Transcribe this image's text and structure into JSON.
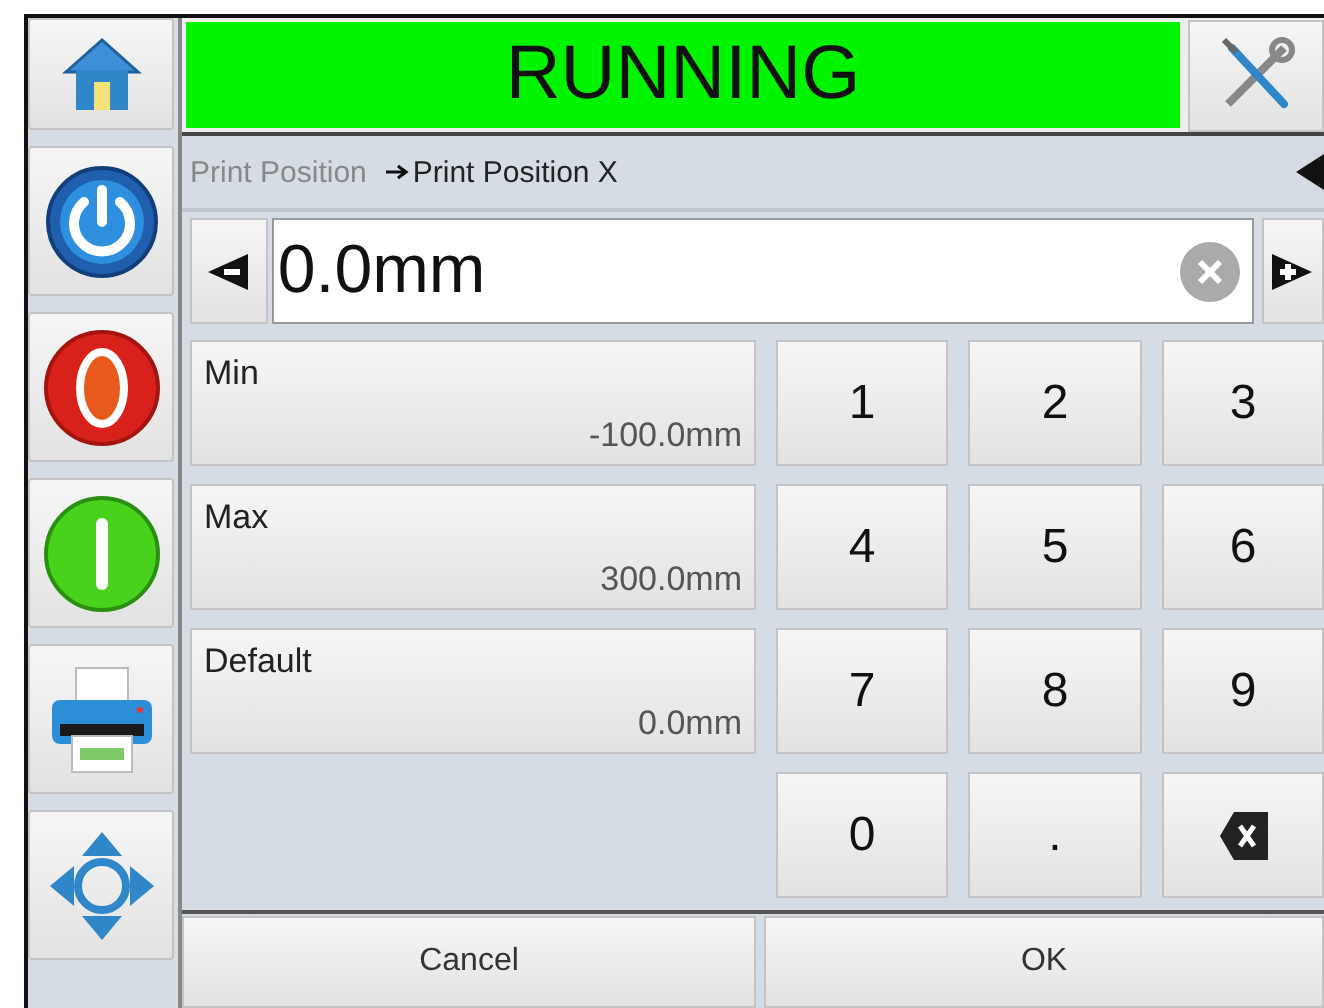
{
  "status_bar": {
    "text": "RUNNING"
  },
  "breadcrumb": {
    "parent": "Print Position",
    "current": "Print Position X"
  },
  "value_field": {
    "value": "0.0mm"
  },
  "limits": [
    {
      "label": "Min",
      "value": "-100.0mm"
    },
    {
      "label": "Max",
      "value": "300.0mm"
    },
    {
      "label": "Default",
      "value": "0.0mm"
    }
  ],
  "keypad": [
    {
      "kind": "key",
      "label": "1"
    },
    {
      "kind": "key",
      "label": "2"
    },
    {
      "kind": "key",
      "label": "3"
    },
    {
      "kind": "key",
      "label": "4"
    },
    {
      "kind": "key",
      "label": "5"
    },
    {
      "kind": "key",
      "label": "6"
    },
    {
      "kind": "key",
      "label": "7"
    },
    {
      "kind": "key",
      "label": "8"
    },
    {
      "kind": "key",
      "label": "9"
    },
    {
      "kind": "key",
      "label": "0"
    },
    {
      "kind": "key",
      "label": "."
    },
    {
      "kind": "backspace"
    }
  ],
  "buttons": [
    "Cancel",
    "OK"
  ]
}
